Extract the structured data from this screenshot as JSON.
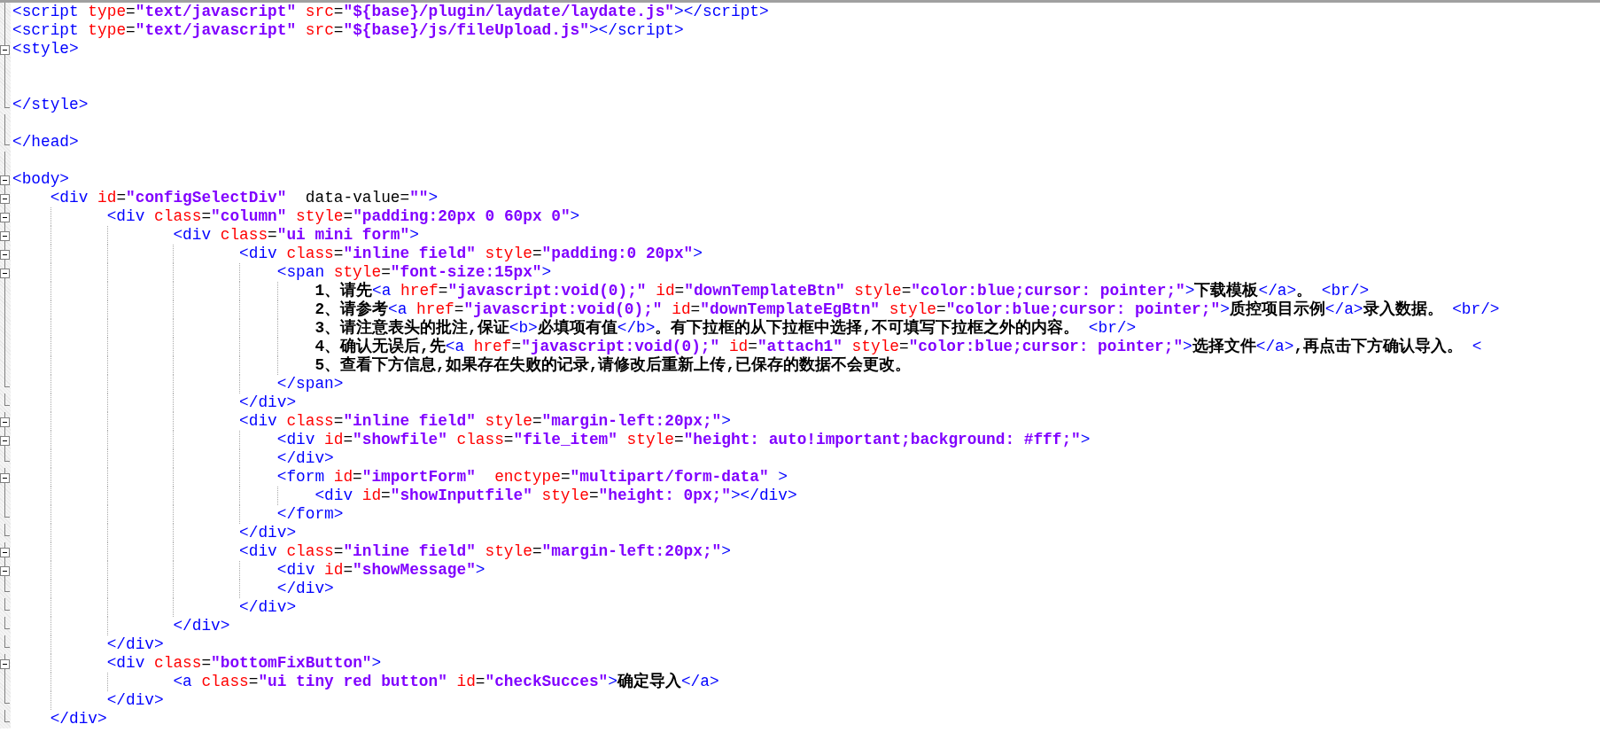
{
  "lines": [
    {
      "kind": "line",
      "tokens": [
        {
          "kind": "tag",
          "text": "<script"
        },
        {
          "kind": "attr",
          "text": " type"
        },
        {
          "kind": "op",
          "text": "="
        },
        {
          "kind": "value",
          "text": "\"text/javascript\""
        },
        {
          "kind": "attr",
          "text": " src"
        },
        {
          "kind": "op",
          "text": "="
        },
        {
          "kind": "value",
          "text": "\"${base}/plugin/laydate/laydate.js\""
        },
        {
          "kind": "tag",
          "text": "></script>"
        }
      ]
    },
    {
      "kind": "line",
      "tokens": [
        {
          "kind": "tag",
          "text": "<script"
        },
        {
          "kind": "attr",
          "text": " type"
        },
        {
          "kind": "op",
          "text": "="
        },
        {
          "kind": "value",
          "text": "\"text/javascript\""
        },
        {
          "kind": "attr",
          "text": " src"
        },
        {
          "kind": "op",
          "text": "="
        },
        {
          "kind": "value",
          "text": "\"${base}/js/fileUpload.js\""
        },
        {
          "kind": "tag",
          "text": "></script>"
        }
      ]
    },
    {
      "kind": "open",
      "tokens": [
        {
          "kind": "tag",
          "text": "<style>"
        }
      ],
      "children": [
        {
          "kind": "line"
        },
        {
          "kind": "line"
        }
      ]
    },
    {
      "kind": "close",
      "tokens": [
        {
          "kind": "tag",
          "text": "</style>"
        }
      ]
    },
    {
      "kind": "line"
    },
    {
      "kind": "close",
      "tokens": [
        {
          "kind": "tag",
          "text": "</head>"
        }
      ]
    },
    {
      "kind": "line"
    },
    {
      "kind": "open",
      "tokens": [
        {
          "kind": "tag",
          "text": "<body>"
        }
      ],
      "children": [
        {
          "kind": "open",
          "tokens": [
            {
              "kind": "tag",
              "text": "<div"
            },
            {
              "kind": "attr",
              "text": " id"
            },
            {
              "kind": "op",
              "text": "="
            },
            {
              "kind": "value",
              "text": "\"configSelectDiv\""
            },
            {
              "kind": "plain",
              "text": "  data-value"
            },
            {
              "kind": "op",
              "text": "="
            },
            {
              "kind": "value",
              "text": "\"\""
            },
            {
              "kind": "tag",
              "text": ">"
            }
          ],
          "children": [
            {
              "kind": "open",
              "tokens": [
                {
                  "kind": "tag",
                  "text": "<div"
                },
                {
                  "kind": "attr",
                  "text": " class"
                },
                {
                  "kind": "op",
                  "text": "="
                },
                {
                  "kind": "value",
                  "text": "\"column\""
                },
                {
                  "kind": "attr",
                  "text": " style"
                },
                {
                  "kind": "op",
                  "text": "="
                },
                {
                  "kind": "value",
                  "text": "\"padding:20px 0 60px 0\""
                },
                {
                  "kind": "tag",
                  "text": ">"
                }
              ],
              "children": [
                {
                  "kind": "open",
                  "tokens": [
                    {
                      "kind": "tag",
                      "text": "<div"
                    },
                    {
                      "kind": "attr",
                      "text": " class"
                    },
                    {
                      "kind": "op",
                      "text": "="
                    },
                    {
                      "kind": "value",
                      "text": "\"ui mini form\""
                    },
                    {
                      "kind": "tag",
                      "text": ">"
                    }
                  ],
                  "children": [
                    {
                      "kind": "open",
                      "tokens": [
                        {
                          "kind": "tag",
                          "text": "<div"
                        },
                        {
                          "kind": "attr",
                          "text": " class"
                        },
                        {
                          "kind": "op",
                          "text": "="
                        },
                        {
                          "kind": "value",
                          "text": "\"inline field\""
                        },
                        {
                          "kind": "attr",
                          "text": " style"
                        },
                        {
                          "kind": "op",
                          "text": "="
                        },
                        {
                          "kind": "value",
                          "text": "\"padding:0 20px\""
                        },
                        {
                          "kind": "tag",
                          "text": ">"
                        }
                      ],
                      "children": [
                        {
                          "kind": "open",
                          "tokens": [
                            {
                              "kind": "tag",
                              "text": "<span"
                            },
                            {
                              "kind": "attr",
                              "text": " style"
                            },
                            {
                              "kind": "op",
                              "text": "="
                            },
                            {
                              "kind": "value",
                              "text": "\"font-size:15px\""
                            },
                            {
                              "kind": "tag",
                              "text": ">"
                            }
                          ],
                          "children": [
                            {
                              "kind": "line",
                              "tokens": [
                                {
                                  "kind": "text",
                                  "text": "1、请先"
                                },
                                {
                                  "kind": "tag",
                                  "text": "<a"
                                },
                                {
                                  "kind": "attr",
                                  "text": " href"
                                },
                                {
                                  "kind": "op",
                                  "text": "="
                                },
                                {
                                  "kind": "value",
                                  "text": "\"javascript:void(0);\""
                                },
                                {
                                  "kind": "attr",
                                  "text": " id"
                                },
                                {
                                  "kind": "op",
                                  "text": "="
                                },
                                {
                                  "kind": "value",
                                  "text": "\"downTemplateBtn\""
                                },
                                {
                                  "kind": "attr",
                                  "text": " style"
                                },
                                {
                                  "kind": "op",
                                  "text": "="
                                },
                                {
                                  "kind": "value",
                                  "text": "\"color:blue;cursor: pointer;\""
                                },
                                {
                                  "kind": "tag",
                                  "text": ">"
                                },
                                {
                                  "kind": "text",
                                  "text": "下载模板"
                                },
                                {
                                  "kind": "tag",
                                  "text": "</a>"
                                },
                                {
                                  "kind": "text",
                                  "text": "。"
                                },
                                {
                                  "kind": "tag",
                                  "text": " <br/>"
                                }
                              ]
                            },
                            {
                              "kind": "line",
                              "tokens": [
                                {
                                  "kind": "text",
                                  "text": "2、请参考"
                                },
                                {
                                  "kind": "tag",
                                  "text": "<a"
                                },
                                {
                                  "kind": "attr",
                                  "text": " href"
                                },
                                {
                                  "kind": "op",
                                  "text": "="
                                },
                                {
                                  "kind": "value",
                                  "text": "\"javascript:void(0);\""
                                },
                                {
                                  "kind": "attr",
                                  "text": " id"
                                },
                                {
                                  "kind": "op",
                                  "text": "="
                                },
                                {
                                  "kind": "value",
                                  "text": "\"downTemplateEgBtn\""
                                },
                                {
                                  "kind": "attr",
                                  "text": " style"
                                },
                                {
                                  "kind": "op",
                                  "text": "="
                                },
                                {
                                  "kind": "value",
                                  "text": "\"color:blue;cursor: pointer;\""
                                },
                                {
                                  "kind": "tag",
                                  "text": ">"
                                },
                                {
                                  "kind": "text",
                                  "text": "质控项目示例"
                                },
                                {
                                  "kind": "tag",
                                  "text": "</a>"
                                },
                                {
                                  "kind": "text",
                                  "text": "录入数据。"
                                },
                                {
                                  "kind": "tag",
                                  "text": " <br/>"
                                }
                              ]
                            },
                            {
                              "kind": "line",
                              "tokens": [
                                {
                                  "kind": "text",
                                  "text": "3、请注意表头的批注,保证"
                                },
                                {
                                  "kind": "tag",
                                  "text": "<b>"
                                },
                                {
                                  "kind": "text",
                                  "text": "必填项有值"
                                },
                                {
                                  "kind": "tag",
                                  "text": "</b>"
                                },
                                {
                                  "kind": "text",
                                  "text": "。有下拉框的从下拉框中选择,不可填写下拉框之外的内容。"
                                },
                                {
                                  "kind": "tag",
                                  "text": " <br/>"
                                }
                              ]
                            },
                            {
                              "kind": "line",
                              "tokens": [
                                {
                                  "kind": "text",
                                  "text": "4、确认无误后,先"
                                },
                                {
                                  "kind": "tag",
                                  "text": "<a"
                                },
                                {
                                  "kind": "attr",
                                  "text": " href"
                                },
                                {
                                  "kind": "op",
                                  "text": "="
                                },
                                {
                                  "kind": "value",
                                  "text": "\"javascript:void(0);\""
                                },
                                {
                                  "kind": "attr",
                                  "text": " id"
                                },
                                {
                                  "kind": "op",
                                  "text": "="
                                },
                                {
                                  "kind": "value",
                                  "text": "\"attach1\""
                                },
                                {
                                  "kind": "attr",
                                  "text": " style"
                                },
                                {
                                  "kind": "op",
                                  "text": "="
                                },
                                {
                                  "kind": "value",
                                  "text": "\"color:blue;cursor: pointer;\""
                                },
                                {
                                  "kind": "tag",
                                  "text": ">"
                                },
                                {
                                  "kind": "text",
                                  "text": "选择文件"
                                },
                                {
                                  "kind": "tag",
                                  "text": "</a>"
                                },
                                {
                                  "kind": "text",
                                  "text": ",再点击下方确认导入。"
                                },
                                {
                                  "kind": "tag",
                                  "text": " <"
                                }
                              ]
                            },
                            {
                              "kind": "line",
                              "tokens": [
                                {
                                  "kind": "text",
                                  "text": "5、查看下方信息,如果存在失败的记录,请修改后重新上传,已保存的数据不会更改。"
                                }
                              ]
                            }
                          ]
                        },
                        {
                          "kind": "close",
                          "tokens": [
                            {
                              "kind": "tag",
                              "text": "</span>"
                            }
                          ]
                        }
                      ]
                    },
                    {
                      "kind": "close",
                      "tokens": [
                        {
                          "kind": "tag",
                          "text": "</div>"
                        }
                      ]
                    },
                    {
                      "kind": "open",
                      "tokens": [
                        {
                          "kind": "tag",
                          "text": "<div"
                        },
                        {
                          "kind": "attr",
                          "text": " class"
                        },
                        {
                          "kind": "op",
                          "text": "="
                        },
                        {
                          "kind": "value",
                          "text": "\"inline field\""
                        },
                        {
                          "kind": "attr",
                          "text": " style"
                        },
                        {
                          "kind": "op",
                          "text": "="
                        },
                        {
                          "kind": "value",
                          "text": "\"margin-left:20px;\""
                        },
                        {
                          "kind": "tag",
                          "text": ">"
                        }
                      ],
                      "children": [
                        {
                          "kind": "open",
                          "tokens": [
                            {
                              "kind": "tag",
                              "text": "<div"
                            },
                            {
                              "kind": "attr",
                              "text": " id"
                            },
                            {
                              "kind": "op",
                              "text": "="
                            },
                            {
                              "kind": "value",
                              "text": "\"showfile\""
                            },
                            {
                              "kind": "attr",
                              "text": " class"
                            },
                            {
                              "kind": "op",
                              "text": "="
                            },
                            {
                              "kind": "value",
                              "text": "\"file_item\""
                            },
                            {
                              "kind": "attr",
                              "text": " style"
                            },
                            {
                              "kind": "op",
                              "text": "="
                            },
                            {
                              "kind": "value",
                              "text": "\"height: auto!important;background: #fff;\""
                            },
                            {
                              "kind": "tag",
                              "text": ">"
                            }
                          ]
                        },
                        {
                          "kind": "close",
                          "tokens": [
                            {
                              "kind": "tag",
                              "text": "</div>"
                            }
                          ]
                        },
                        {
                          "kind": "open",
                          "tokens": [
                            {
                              "kind": "tag",
                              "text": "<form"
                            },
                            {
                              "kind": "attr",
                              "text": " id"
                            },
                            {
                              "kind": "op",
                              "text": "="
                            },
                            {
                              "kind": "value",
                              "text": "\"importForm\""
                            },
                            {
                              "kind": "attr",
                              "text": "  enctype"
                            },
                            {
                              "kind": "op",
                              "text": "="
                            },
                            {
                              "kind": "value",
                              "text": "\"multipart/form-data\""
                            },
                            {
                              "kind": "tag",
                              "text": " >"
                            }
                          ],
                          "children": [
                            {
                              "kind": "line",
                              "tokens": [
                                {
                                  "kind": "tag",
                                  "text": "<div"
                                },
                                {
                                  "kind": "attr",
                                  "text": " id"
                                },
                                {
                                  "kind": "op",
                                  "text": "="
                                },
                                {
                                  "kind": "value",
                                  "text": "\"showInputfile\""
                                },
                                {
                                  "kind": "attr",
                                  "text": " style"
                                },
                                {
                                  "kind": "op",
                                  "text": "="
                                },
                                {
                                  "kind": "value",
                                  "text": "\"height: 0px;\""
                                },
                                {
                                  "kind": "tag",
                                  "text": "></div>"
                                }
                              ]
                            }
                          ]
                        },
                        {
                          "kind": "close",
                          "tokens": [
                            {
                              "kind": "tag",
                              "text": "</form>"
                            }
                          ]
                        }
                      ]
                    },
                    {
                      "kind": "close",
                      "tokens": [
                        {
                          "kind": "tag",
                          "text": "</div>"
                        }
                      ]
                    },
                    {
                      "kind": "open",
                      "tokens": [
                        {
                          "kind": "tag",
                          "text": "<div"
                        },
                        {
                          "kind": "attr",
                          "text": " class"
                        },
                        {
                          "kind": "op",
                          "text": "="
                        },
                        {
                          "kind": "value",
                          "text": "\"inline field\""
                        },
                        {
                          "kind": "attr",
                          "text": " style"
                        },
                        {
                          "kind": "op",
                          "text": "="
                        },
                        {
                          "kind": "value",
                          "text": "\"margin-left:20px;\""
                        },
                        {
                          "kind": "tag",
                          "text": ">"
                        }
                      ],
                      "children": [
                        {
                          "kind": "open",
                          "tokens": [
                            {
                              "kind": "tag",
                              "text": "<div"
                            },
                            {
                              "kind": "attr",
                              "text": " id"
                            },
                            {
                              "kind": "op",
                              "text": "="
                            },
                            {
                              "kind": "value",
                              "text": "\"showMessage\""
                            },
                            {
                              "kind": "tag",
                              "text": ">"
                            }
                          ]
                        },
                        {
                          "kind": "close",
                          "tokens": [
                            {
                              "kind": "tag",
                              "text": "</div>"
                            }
                          ]
                        }
                      ]
                    },
                    {
                      "kind": "close",
                      "tokens": [
                        {
                          "kind": "tag",
                          "text": "</div>"
                        }
                      ]
                    }
                  ]
                },
                {
                  "kind": "close",
                  "tokens": [
                    {
                      "kind": "tag",
                      "text": "</div>"
                    }
                  ]
                }
              ]
            },
            {
              "kind": "close",
              "tokens": [
                {
                  "kind": "tag",
                  "text": "</div>"
                }
              ]
            },
            {
              "kind": "open",
              "tokens": [
                {
                  "kind": "tag",
                  "text": "<div"
                },
                {
                  "kind": "attr",
                  "text": " class"
                },
                {
                  "kind": "op",
                  "text": "="
                },
                {
                  "kind": "value",
                  "text": "\"bottomFixButton\""
                },
                {
                  "kind": "tag",
                  "text": ">"
                }
              ],
              "children": [
                {
                  "kind": "line",
                  "tokens": [
                    {
                      "kind": "tag",
                      "text": "<a"
                    },
                    {
                      "kind": "attr",
                      "text": " class"
                    },
                    {
                      "kind": "op",
                      "text": "="
                    },
                    {
                      "kind": "value",
                      "text": "\"ui tiny red button\""
                    },
                    {
                      "kind": "attr",
                      "text": " id"
                    },
                    {
                      "kind": "op",
                      "text": "="
                    },
                    {
                      "kind": "value",
                      "text": "\"checkSucces\""
                    },
                    {
                      "kind": "tag",
                      "text": ">"
                    },
                    {
                      "kind": "text",
                      "text": "确定导入"
                    },
                    {
                      "kind": "tag",
                      "text": "</a>"
                    }
                  ]
                }
              ]
            },
            {
              "kind": "close",
              "tokens": [
                {
                  "kind": "tag",
                  "text": "</div>"
                }
              ]
            }
          ]
        },
        {
          "kind": "close",
          "tokens": [
            {
              "kind": "tag",
              "text": "</div>"
            }
          ]
        }
      ]
    }
  ]
}
